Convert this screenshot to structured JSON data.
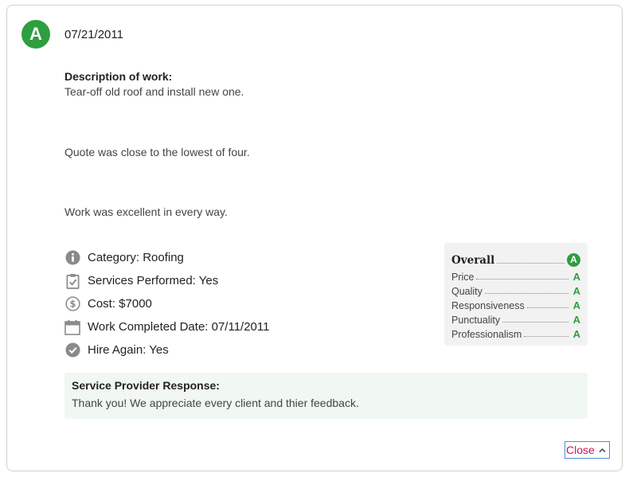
{
  "review": {
    "grade": "A",
    "date": "07/21/2011",
    "description_label": "Description of work:",
    "description_lines": [
      "Tear-off old roof and install new one.",
      "Quote was close to the lowest of four.",
      "Work was excellent in every way."
    ]
  },
  "facts": {
    "category": "Category: Roofing",
    "services": "Services Performed: Yes",
    "cost": "Cost: $7000",
    "completed": "Work Completed Date: 07/11/2011",
    "hire_again": "Hire Again: Yes"
  },
  "ratings": {
    "overall": {
      "label": "Overall",
      "grade": "A"
    },
    "items": [
      {
        "label": "Price",
        "grade": "A"
      },
      {
        "label": "Quality",
        "grade": "A"
      },
      {
        "label": "Responsiveness",
        "grade": "A"
      },
      {
        "label": "Punctuality",
        "grade": "A"
      },
      {
        "label": "Professionalism",
        "grade": "A"
      }
    ]
  },
  "response": {
    "label": "Service Provider Response:",
    "text": "Thank you! We appreciate every client and thier feedback."
  },
  "close_label": "Close",
  "colors": {
    "grade_green": "#2e9e3f",
    "close_text": "#c2185b",
    "close_border": "#4a90d9",
    "response_bg": "#f1f8f1",
    "ratings_bg": "#f2f2f2",
    "icon_gray": "#8a8a8a"
  },
  "icons": [
    "info-icon",
    "clipboard-check-icon",
    "dollar-icon",
    "calendar-icon",
    "check-circle-icon",
    "chevron-up-icon"
  ]
}
